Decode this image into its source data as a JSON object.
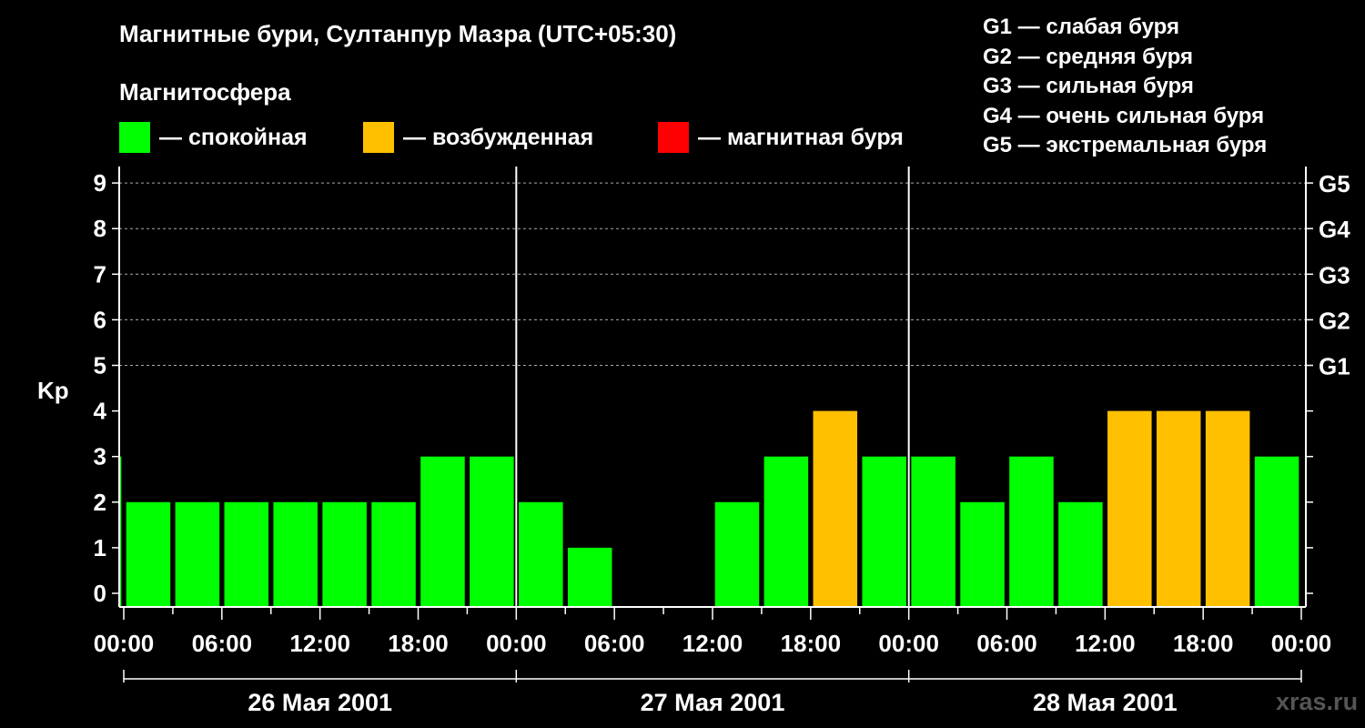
{
  "title": "Магнитные бури, Султанпур Мазра (UTC+05:30)",
  "subtitle": "Магнитосфера",
  "colors": {
    "calm": "#00ff00",
    "disturbed": "#ffc000",
    "storm": "#ff0000",
    "background": "#000000",
    "axis": "#ffffff"
  },
  "legend": [
    {
      "label": "— спокойная",
      "color": "#00ff00"
    },
    {
      "label": "— возбужденная",
      "color": "#ffc000"
    },
    {
      "label": "— магнитная буря",
      "color": "#ff0000"
    }
  ],
  "g_legend": [
    "G1 — слабая буря",
    "G2 — средняя буря",
    "G3 — сильная буря",
    "G4 — очень сильная буря",
    "G5 — экстремальная буря"
  ],
  "watermark": "xras.ru",
  "chart_data": {
    "type": "bar",
    "ylabel": "Kp",
    "ylim": [
      0,
      9
    ],
    "y_ticks": [
      "0",
      "1",
      "2",
      "3",
      "4",
      "5",
      "6",
      "7",
      "8",
      "9"
    ],
    "g_ticks": [
      {
        "label": "G1",
        "kp": 5
      },
      {
        "label": "G2",
        "kp": 6
      },
      {
        "label": "G3",
        "kp": 7
      },
      {
        "label": "G4",
        "kp": 8
      },
      {
        "label": "G5",
        "kp": 9
      }
    ],
    "x_tick_labels": [
      "00:00",
      "06:00",
      "12:00",
      "18:00",
      "00:00",
      "06:00",
      "12:00",
      "18:00",
      "00:00",
      "06:00",
      "12:00",
      "18:00",
      "00:00"
    ],
    "days": [
      "26 Мая 2001",
      "27 Мая 2001",
      "28 Мая 2001"
    ],
    "bar_interval_hours": 3,
    "first_bar_hour": -1.5,
    "kp_values": [
      3,
      2,
      2,
      2,
      2,
      2,
      2,
      3,
      3,
      2,
      1,
      0,
      0,
      2,
      3,
      4,
      3,
      3,
      2,
      3,
      2,
      4,
      4,
      4,
      3
    ],
    "calm_max_kp": 3,
    "storm_min_kp": 5,
    "grid": "dashed horizontal lines at Kp 5–9"
  }
}
